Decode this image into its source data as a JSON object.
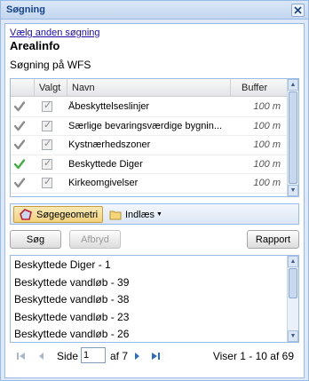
{
  "window": {
    "title": "Søgning"
  },
  "header": {
    "link": "Vælg anden søgning",
    "title": "Arealinfo",
    "subtitle": "Søgning på WFS"
  },
  "grid": {
    "columns": {
      "selected": "Valgt",
      "name": "Navn",
      "buffer": "Buffer"
    },
    "rows": [
      {
        "status": "inactive",
        "selected": true,
        "name": "Åbeskyttelseslinjer",
        "buffer": "100 m"
      },
      {
        "status": "inactive",
        "selected": true,
        "name": "Særlige bevaringsværdige bygnin...",
        "buffer": "100 m"
      },
      {
        "status": "inactive",
        "selected": true,
        "name": "Kystnærhedszoner",
        "buffer": "100 m"
      },
      {
        "status": "active",
        "selected": true,
        "name": "Beskyttede Diger",
        "buffer": "100 m"
      },
      {
        "status": "inactive",
        "selected": true,
        "name": "Kirkeomgivelser",
        "buffer": "100 m"
      }
    ]
  },
  "toolbar": {
    "search_geometry": "Søgegeometri",
    "import": "Indlæs"
  },
  "actions": {
    "search": "Søg",
    "cancel": "Afbryd",
    "report": "Rapport"
  },
  "results": [
    "Beskyttede Diger - 1",
    "Beskyttede vandløb - 39",
    "Beskyttede vandløb - 38",
    "Beskyttede vandløb - 23",
    "Beskyttede vandløb - 26"
  ],
  "pager": {
    "page_label": "Side",
    "page_value": "1",
    "of_label": "af 7",
    "summary": "Viser 1 - 10 af 69"
  },
  "colors": {
    "accent": "#15428b",
    "border": "#99bbe8",
    "active_check": "#3fae3f",
    "inactive_check": "#8c8c8c"
  }
}
